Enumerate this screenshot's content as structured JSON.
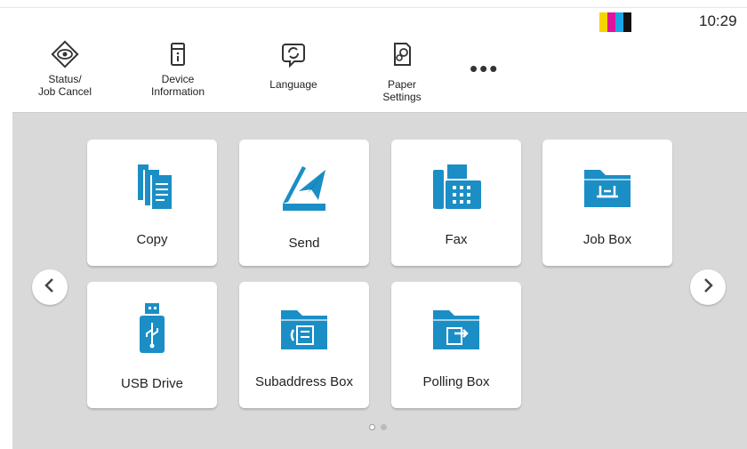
{
  "status_bar": {
    "time": "10:29",
    "ink_colors": [
      "#f5d400",
      "#e0149c",
      "#1aa6e6",
      "#111111"
    ]
  },
  "shortcuts": [
    {
      "label": "Status/\nJob Cancel",
      "icon": "eye-icon"
    },
    {
      "label": "Device\nInformation",
      "icon": "device-info-icon"
    },
    {
      "label": "Language",
      "icon": "language-icon"
    },
    {
      "label": "Paper\nSettings",
      "icon": "paper-settings-icon"
    }
  ],
  "more_label": "•••",
  "functions": [
    {
      "label": "Copy",
      "icon": "copy-icon"
    },
    {
      "label": "Send",
      "icon": "send-icon"
    },
    {
      "label": "Fax",
      "icon": "fax-icon"
    },
    {
      "label": "Job Box",
      "icon": "job-box-icon"
    },
    {
      "label": "USB Drive",
      "icon": "usb-drive-icon"
    },
    {
      "label": "Subaddress Box",
      "icon": "subaddress-box-icon"
    },
    {
      "label": "Polling Box",
      "icon": "polling-box-icon"
    }
  ],
  "pagination": {
    "pages": 2,
    "current": 1
  },
  "colors": {
    "accent": "#1b8ec6",
    "panel_bg": "#d9d9d9"
  }
}
